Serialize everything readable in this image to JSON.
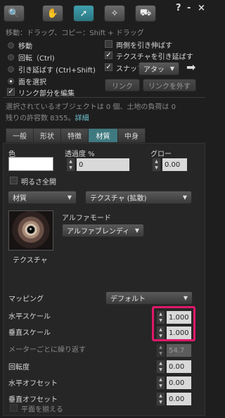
{
  "toolbar": {
    "tools": [
      "magnifier-icon",
      "hand-icon",
      "cursor-icon",
      "wand-icon",
      "bulldozer-icon"
    ],
    "help": "?",
    "minimize": "-",
    "close": "×"
  },
  "hint": "移動：ドラッグ、コピー：Shift + ドラッグ",
  "edit_modes": {
    "move": "移動",
    "rotate": "回転（Ctrl)",
    "stretch": "引き延ばす (Ctrl+Shift)",
    "select_face": "面を選択"
  },
  "options": {
    "stretch_both": "両側を引き伸ばす",
    "stretch_textures": "テクスチャを引き延ばす",
    "snap": "スナップ",
    "snap_mode": "アタッ",
    "edit_linked": "リンク部分を編集"
  },
  "buttons": {
    "link": "リンク",
    "unlink": "リンクを外す"
  },
  "status": {
    "line1": "選択されているオブジェクトは 0 個、土地の負荷は 0",
    "line2": "残りの許容数 8355。",
    "details": "詳細"
  },
  "tabs": [
    "一般",
    "形状",
    "特徴",
    "材質",
    "中身"
  ],
  "active_tab": "材質",
  "appearance": {
    "color_label": "色",
    "transparency_label": "透過度 %",
    "transparency_value": "0",
    "glow_label": "グロー",
    "glow_value": "0.00",
    "full_bright": "明るさ全開"
  },
  "material": {
    "type_value": "材質",
    "texture_kind_value": "テクスチャ (拡散)",
    "texture_label": "テクスチャ",
    "alpha_mode_label": "アルファモード",
    "alpha_mode_value": "アルファブレンディ"
  },
  "mapping": {
    "label": "マッピング",
    "value": "デフォルト",
    "h_scale_label": "水平スケール",
    "h_scale_value": "1.000",
    "v_scale_label": "垂直スケール",
    "v_scale_value": "1.000",
    "repeats_label": "メーターごとに繰り返す",
    "repeats_value": "54.7",
    "rotation_label": "回転度",
    "rotation_value": "0.00",
    "h_offset_label": "水平オフセット",
    "h_offset_value": "0.00",
    "v_offset_label": "垂直オフセット",
    "v_offset_value": "0.00",
    "align_planar": "平面を揃える"
  },
  "colors": {
    "accent": "#3f7a80",
    "highlight": "#e0186a"
  }
}
